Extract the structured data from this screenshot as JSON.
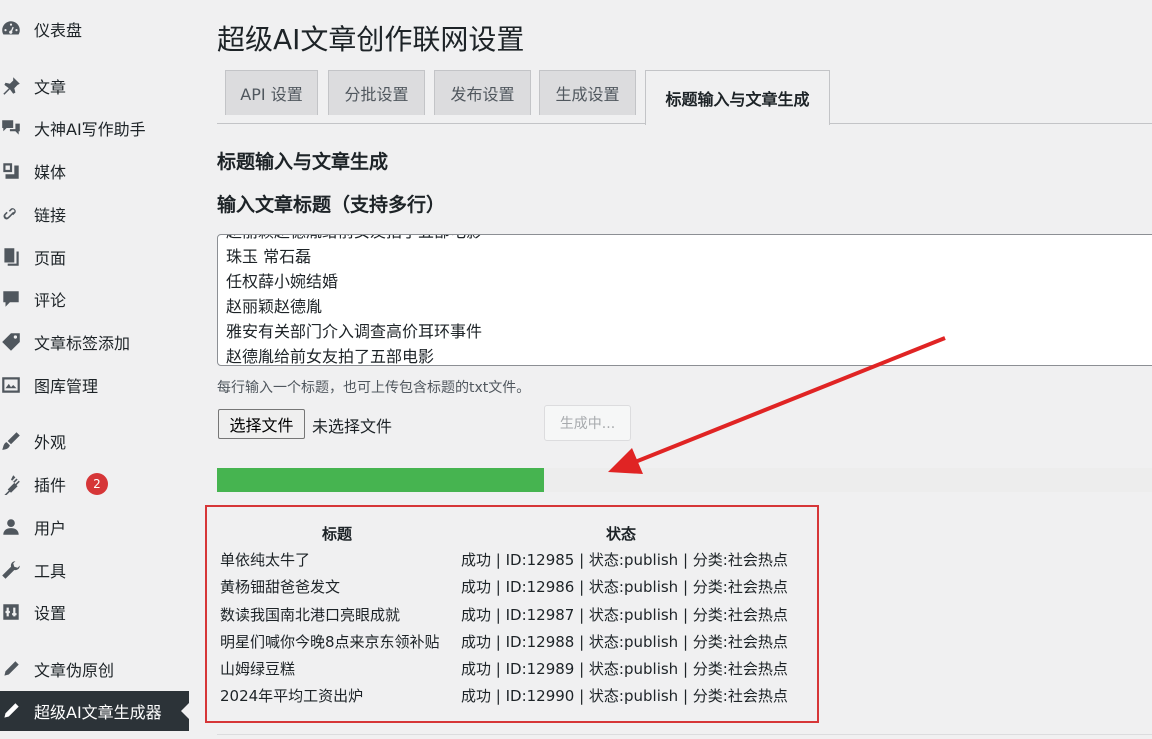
{
  "sidebar": {
    "items": [
      {
        "label": "仪表盘",
        "icon": "dashboard-icon"
      },
      {
        "label": "文章",
        "icon": "pin-icon"
      },
      {
        "label": "大神AI写作助手",
        "icon": "comments-icon"
      },
      {
        "label": "媒体",
        "icon": "media-icon"
      },
      {
        "label": "链接",
        "icon": "link-icon"
      },
      {
        "label": "页面",
        "icon": "page-icon"
      },
      {
        "label": "评论",
        "icon": "comment-icon"
      },
      {
        "label": "文章标签添加",
        "icon": "tag-icon"
      },
      {
        "label": "图库管理",
        "icon": "gallery-icon"
      },
      {
        "label": "外观",
        "icon": "brush-icon"
      },
      {
        "label": "插件",
        "icon": "plugin-icon",
        "badge": "2"
      },
      {
        "label": "用户",
        "icon": "user-icon"
      },
      {
        "label": "工具",
        "icon": "wrench-icon"
      },
      {
        "label": "设置",
        "icon": "settings-icon"
      },
      {
        "label": "文章伪原创",
        "icon": "edit-icon"
      },
      {
        "label": "超级AI文章生成器",
        "icon": "edit-icon",
        "active": true
      }
    ]
  },
  "page": {
    "title": "超级AI文章创作联网设置"
  },
  "tabs": [
    {
      "label": "API 设置"
    },
    {
      "label": "分批设置"
    },
    {
      "label": "发布设置"
    },
    {
      "label": "生成设置"
    },
    {
      "label": "标题输入与文章生成",
      "active": true
    }
  ],
  "section": {
    "heading": "标题输入与文章生成",
    "input_label": "输入文章标题（支持多行）",
    "titles": [
      "赵丽颖赵德胤给前女友拍了五部电影",
      "珠玉 常石磊",
      "任权薛小婉结婚",
      "赵丽颖赵德胤",
      "雅安有关部门介入调查高价耳环事件",
      "赵德胤给前女友拍了五部电影"
    ],
    "help_text": "每行输入一个标题，也可上传包含标题的txt文件。",
    "file_button": "选择文件",
    "file_status": "未选择文件",
    "generate_button": "生成中..."
  },
  "progress": {
    "fraction": 0.35,
    "color": "#46b450"
  },
  "results": {
    "headers": {
      "title": "标题",
      "status": "状态"
    },
    "rows": [
      {
        "title": "单依纯太牛了",
        "status": "成功 | ID:12985 | 状态:publish | 分类:社会热点"
      },
      {
        "title": "黄杨钿甜爸爸发文",
        "status": "成功 | ID:12986 | 状态:publish | 分类:社会热点"
      },
      {
        "title": "数读我国南北港口亮眼成就",
        "status": "成功 | ID:12987 | 状态:publish | 分类:社会热点"
      },
      {
        "title": "明星们喊你今晚8点来京东领补贴",
        "status": "成功 | ID:12988 | 状态:publish | 分类:社会热点"
      },
      {
        "title": "山姆绿豆糕",
        "status": "成功 | ID:12989 | 状态:publish | 分类:社会热点"
      },
      {
        "title": "2024年平均工资出炉",
        "status": "成功 | ID:12990 | 状态:publish | 分类:社会热点"
      }
    ]
  },
  "colors": {
    "highlight_box": "#d63638",
    "arrow": "#e02424",
    "active_menu": "#2c3338"
  }
}
